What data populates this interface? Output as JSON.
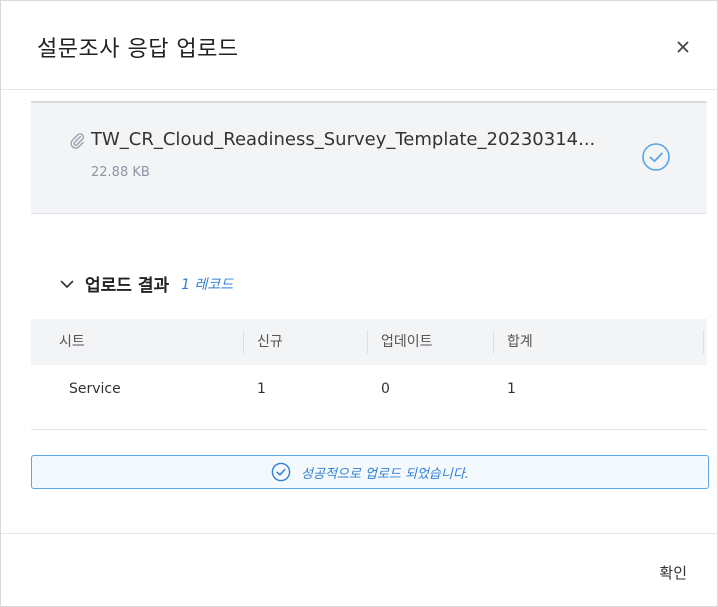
{
  "dialog": {
    "title": "설문조사 응답 업로드",
    "close_icon": "close-icon"
  },
  "file": {
    "icon": "paperclip-icon",
    "name": "TW_CR_Cloud_Readiness_Survey_Template_20230314...",
    "size": "22.88 KB",
    "status_icon": "check-circle-icon"
  },
  "result": {
    "title": "업로드 결과",
    "record_count": "1 레코드",
    "columns": [
      "시트",
      "신규",
      "업데이트",
      "합계"
    ],
    "rows": [
      [
        "Service",
        "1",
        "0",
        "1"
      ]
    ]
  },
  "success": {
    "icon": "check-circle-icon",
    "message": "성공적으로 업로드 되었습니다."
  },
  "footer": {
    "ok_label": "확인"
  },
  "colors": {
    "accent": "#2f7fd6",
    "card_bg": "#f3f4f6",
    "success_border": "#5aa7e8"
  }
}
